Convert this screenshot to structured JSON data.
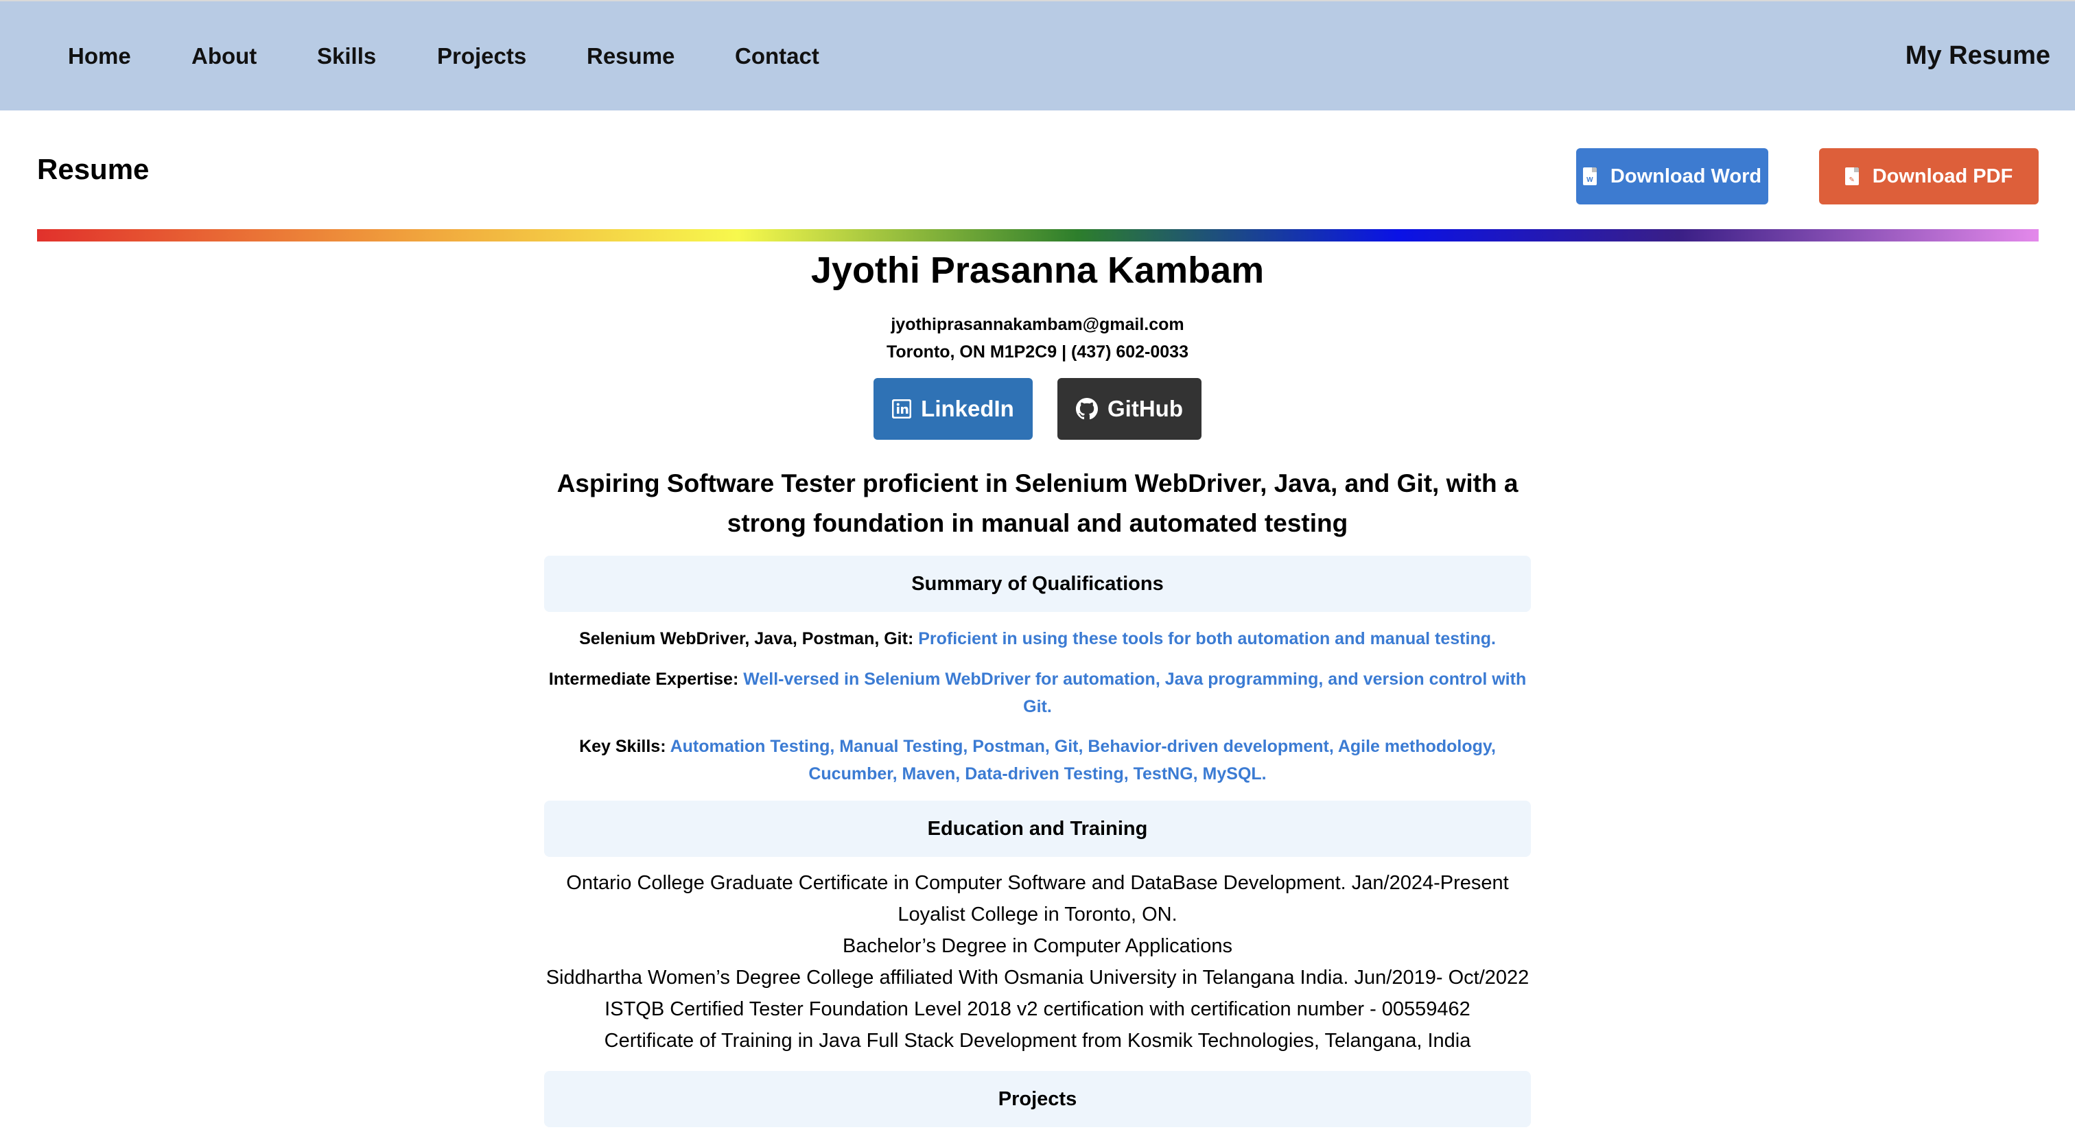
{
  "nav": {
    "items": [
      "Home",
      "About",
      "Skills",
      "Projects",
      "Resume",
      "Contact"
    ],
    "brand": "My Resume"
  },
  "page": {
    "title": "Resume",
    "download_word": "Download Word",
    "download_pdf": "Download PDF"
  },
  "profile": {
    "name": "Jyothi Prasanna Kambam",
    "email": "jyothiprasannakambam@gmail.com",
    "address_phone": "Toronto, ON M1P2C9 | (437) 602-0033",
    "linkedin": "LinkedIn",
    "github": "GitHub",
    "tagline": "Aspiring Software Tester proficient in Selenium WebDriver, Java, and Git, with a strong foundation in manual and automated testing"
  },
  "qualifications": {
    "heading": "Summary of Qualifications",
    "items": [
      {
        "label": "Selenium WebDriver, Java, Postman, Git:",
        "text": "Proficient in using these tools for both automation and manual testing."
      },
      {
        "label": "Intermediate Expertise:",
        "text": "Well-versed in Selenium WebDriver for automation, Java programming, and version control with Git."
      },
      {
        "label": "Key Skills:",
        "text": "Automation Testing, Manual Testing, Postman, Git, Behavior-driven development, Agile methodology, Cucumber, Maven, Data-driven Testing, TestNG, MySQL."
      }
    ]
  },
  "education": {
    "heading": "Education and Training",
    "lines": [
      "Ontario College Graduate Certificate in Computer Software and DataBase Development. Jan/2024-Present",
      "Loyalist College in Toronto, ON.",
      "Bachelor’s Degree in Computer Applications",
      "Siddhartha Women’s Degree College affiliated With Osmania University in Telangana India. Jun/2019- Oct/2022",
      "ISTQB Certified Tester Foundation Level 2018 v2 certification with certification number - 00559462",
      "Certificate of Training in Java Full Stack Development from Kosmik Technologies, Telangana, India"
    ]
  },
  "projects": {
    "heading": "Projects"
  },
  "colors": {
    "nav_bg": "#b8cbe4",
    "word_button": "#3d7bd0",
    "pdf_button": "#dd5f3a",
    "linkedin_button": "#2f72b5",
    "github_button": "#333333",
    "section_bg": "#eef5fc",
    "value_text": "#3b7bd3"
  },
  "icons": {
    "word": "file-word-icon",
    "pdf": "file-pdf-icon",
    "linkedin": "linkedin-icon",
    "github": "github-icon"
  }
}
